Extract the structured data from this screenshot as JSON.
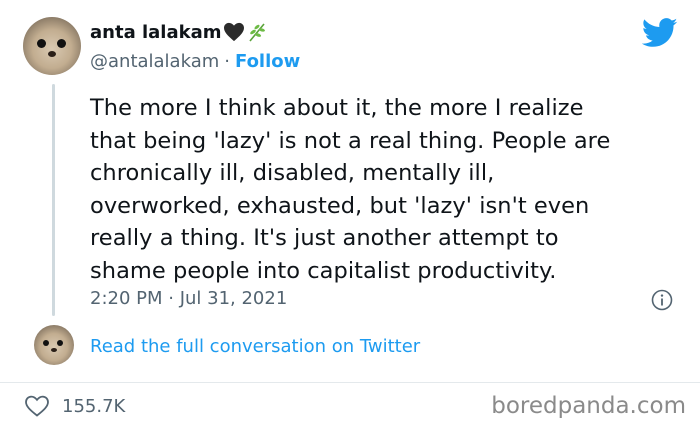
{
  "tweet": {
    "display_name": "anta lalakam",
    "handle": "@antalalakam",
    "separator": "·",
    "follow_label": "Follow",
    "text": "The more I think about it, the more I realize\nthat being 'lazy' is not a real thing. People are\nchronically ill, disabled, mentally ill,\noverworked, exhausted, but 'lazy' isn't even\nreally a thing. It's just another attempt to\nshame people into capitalist productivity.",
    "timestamp": "2:20 PM · Jul 31, 2021",
    "read_more_label": "Read the full conversation on Twitter",
    "like_count": "155.7K"
  },
  "watermark": "boredpanda.com",
  "icons": {
    "name_emoji_1": "black-heart-icon",
    "name_emoji_2": "sprout-icon",
    "brand": "twitter-bird-icon",
    "info": "info-icon",
    "like": "heart-outline-icon"
  },
  "colors": {
    "link": "#1d9bf0",
    "text": "#0f1419",
    "secondary": "#536471",
    "twitter_blue": "#1d9bf0"
  }
}
